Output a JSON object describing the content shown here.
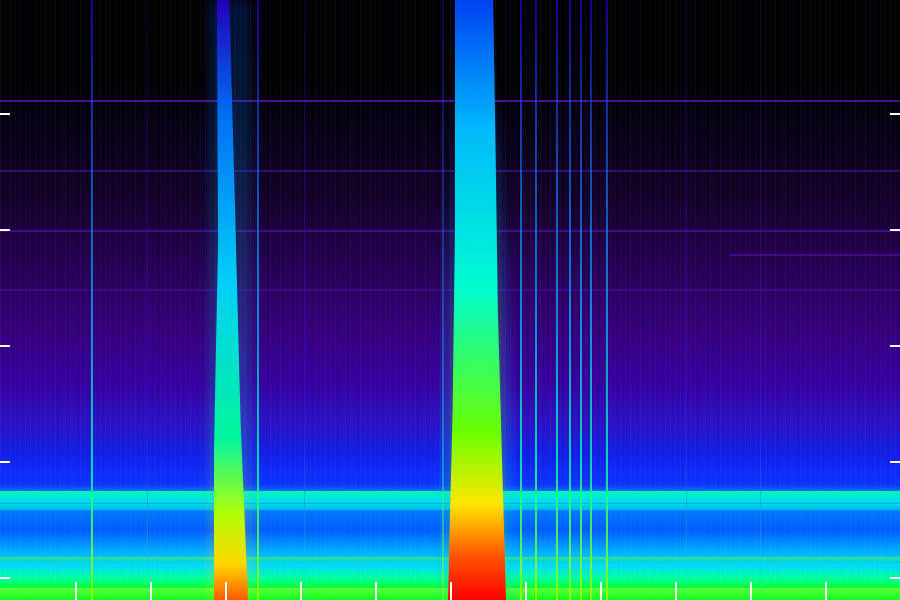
{
  "spectrogram": {
    "colors": {
      "background": "#000000",
      "low_intensity": "#3a008f",
      "mid_intensity": "#00c8ff",
      "high_intensity": "#ffff00",
      "peak_intensity": "#ff0000"
    }
  }
}
